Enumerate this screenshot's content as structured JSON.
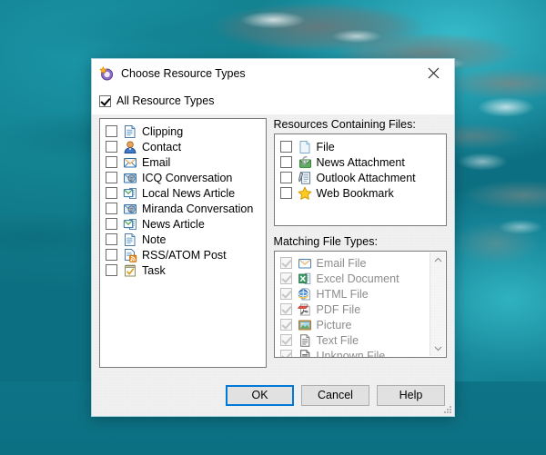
{
  "desktop": {
    "wallpaper_description": "aerial-ocean-reef-photo",
    "water_color": "#0e7a8d",
    "shallow_color": "#38becd",
    "reef_color": "#6c7678"
  },
  "dialog": {
    "title": "Choose Resource Types",
    "title_icon": "resource-types-icon",
    "close_icon": "close-icon",
    "all_resource_types": {
      "label": "All Resource Types",
      "checked": true
    },
    "resource_types": [
      {
        "label": "Clipping",
        "icon": "clipping-icon",
        "checked": false
      },
      {
        "label": "Contact",
        "icon": "contact-icon",
        "checked": false
      },
      {
        "label": "Email",
        "icon": "email-icon",
        "checked": false
      },
      {
        "label": "ICQ Conversation",
        "icon": "icq-conversation-icon",
        "checked": false
      },
      {
        "label": "Local News Article",
        "icon": "local-news-article-icon",
        "checked": false
      },
      {
        "label": "Miranda Conversation",
        "icon": "miranda-conversation-icon",
        "checked": false
      },
      {
        "label": "News Article",
        "icon": "news-article-icon",
        "checked": false
      },
      {
        "label": "Note",
        "icon": "note-icon",
        "checked": false
      },
      {
        "label": "RSS/ATOM Post",
        "icon": "rss-atom-post-icon",
        "checked": false
      },
      {
        "label": "Task",
        "icon": "task-icon",
        "checked": false
      }
    ],
    "resources_containing_files": {
      "label": "Resources Containing Files:",
      "items": [
        {
          "label": "File",
          "icon": "file-icon",
          "checked": false
        },
        {
          "label": "News Attachment",
          "icon": "news-attachment-icon",
          "checked": false
        },
        {
          "label": "Outlook Attachment",
          "icon": "outlook-attachment-icon",
          "checked": false
        },
        {
          "label": "Web Bookmark",
          "icon": "web-bookmark-icon",
          "checked": false
        }
      ]
    },
    "matching_file_types": {
      "label": "Matching File Types:",
      "disabled": true,
      "scroll_up_icon": "chevron-up-icon",
      "scroll_down_icon": "chevron-down-icon",
      "items": [
        {
          "label": "Email File",
          "icon": "email-file-icon",
          "checked": true
        },
        {
          "label": "Excel Document",
          "icon": "excel-document-icon",
          "checked": true
        },
        {
          "label": "HTML File",
          "icon": "html-file-icon",
          "checked": true
        },
        {
          "label": "PDF File",
          "icon": "pdf-file-icon",
          "checked": true
        },
        {
          "label": "Picture",
          "icon": "picture-icon",
          "checked": true
        },
        {
          "label": "Text File",
          "icon": "text-file-icon",
          "checked": true
        },
        {
          "label": "Unknown File",
          "icon": "unknown-file-icon",
          "checked": true
        }
      ]
    },
    "buttons": {
      "ok": "OK",
      "cancel": "Cancel",
      "help": "Help",
      "default": "OK",
      "focus_color": "#0078d7"
    },
    "resize_grip_icon": "resize-grip-icon"
  }
}
